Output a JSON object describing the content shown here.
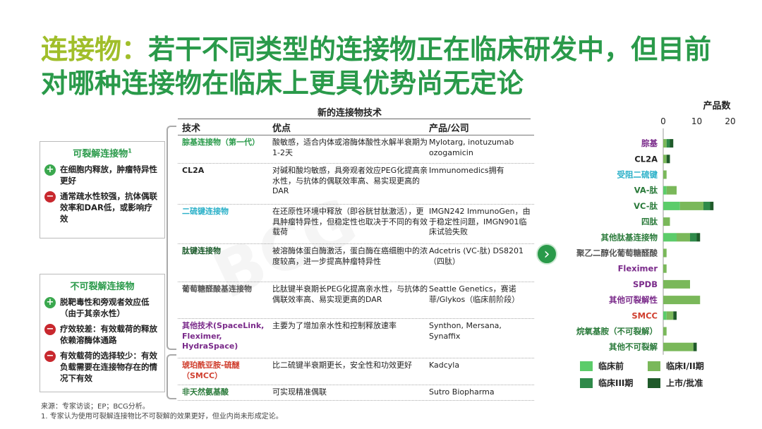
{
  "title": {
    "keyword": "连接物：",
    "rest": "若干不同类型的连接物正在临床研发中，但目前对哪种连接物在临床上更具优势尚无定论"
  },
  "subtitle": "新的连接物技术",
  "cleavable": {
    "title": "可裂解连接物",
    "sup": "1",
    "pros_cons": [
      {
        "type": "plus",
        "text": "在细胞内释放，肿瘤特异性更好"
      },
      {
        "type": "minus",
        "text": "通常疏水性较强，抗体偶联效率和DAR低，或影响疗效"
      }
    ]
  },
  "noncleavable": {
    "title": "不可裂解连接物",
    "pros_cons": [
      {
        "type": "plus",
        "text": "脱靶毒性和旁观者效应低（由于其亲水性）"
      },
      {
        "type": "minus",
        "text": "疗效较差：有效载荷的释放依赖溶酶体通路"
      },
      {
        "type": "minus",
        "text": "有效载荷的选择较少：有效负载需要在连接物存在的情况下有效"
      }
    ]
  },
  "table": {
    "headers": [
      "技术",
      "优点",
      "产品/公司"
    ],
    "rows": [
      {
        "tech": "腙基连接物（第一代）",
        "tech_color": "#2a9a4a",
        "adv": "酸敏感，适合内体或溶酶体酸性水解半衰期为1-2天",
        "prod": "Mylotarg, inotuzumab ozogamicin"
      },
      {
        "tech": "CL2A",
        "tech_color": "#222222",
        "adv": "对碱和酸均敏感，具旁观者效应PEG化提高亲水性，与抗体的偶联效率高、易实现更高的DAR",
        "prod": "Immunomedics拥有"
      },
      {
        "tech": "二硫键连接物",
        "tech_color": "#2ab0c8",
        "adv": "在还原性环境中释放（即谷胱甘肽激活），更具肿瘤特异性，但稳定性也取决于不同的有效载荷",
        "prod": "IMGN242 ImmunoGen，由于稳定性问题，IMGN901临床试验失败"
      },
      {
        "tech": "肽键连接物",
        "tech_color": "#1a5a2a",
        "adv": "被溶酶体蛋白酶激活，蛋白酶在癌细胞中的浓度较高，进一步提高肿瘤特异性",
        "prod": "Adcetris (VC-肽) DS8201（四肽）"
      },
      {
        "tech": "葡萄糖醛酸基连接物",
        "tech_color": "#555555",
        "adv": "比肽键半衰期长PEG化提高亲水性，与抗体的偶联效率高、易实现更高的DAR",
        "prod": "Seattle Genetics，赛诺菲/Glykos（临床前阶段）"
      },
      {
        "tech": "其他技术(SpaceLink, Fleximer, HydraSpace)",
        "tech_color": "#7a2a8a",
        "adv": "主要为了增加亲水性和控制释放速率",
        "prod": "Synthon, Mersana, Synaffix"
      },
      {
        "tech": "琥珀酰亚胺-硫醚（SMCC）",
        "tech_color": "#d04030",
        "adv": "比二硫键半衰期更长，安全性和功效更好",
        "prod": "Kadcyla"
      },
      {
        "tech": "非天然氨基酸",
        "tech_color": "#2a7a3a",
        "adv": "可实现精准偶联",
        "prod": "Sutro Biopharma"
      }
    ]
  },
  "chart_data": {
    "type": "bar",
    "orientation": "horizontal",
    "stacked": true,
    "title": "产品数",
    "xlim": [
      0,
      20
    ],
    "xticks": [
      0,
      10,
      20
    ],
    "categories": [
      "腙基",
      "CL2A",
      "受阻二硫键",
      "VA-肽",
      "VC-肽",
      "四肽",
      "其他肽基连接物",
      "聚乙二醇化葡萄糖醛酸",
      "Fleximer",
      "SPDB",
      "其他可裂解性",
      "SMCC",
      "烷氧基胺（不可裂解）",
      "其他不可裂解"
    ],
    "category_colors": [
      "#7a2a8a",
      "#222222",
      "#2ab0c8",
      "#2a7a3a",
      "#2a7a3a",
      "#2a7a3a",
      "#2a7a3a",
      "#555555",
      "#7a2a8a",
      "#7a2a8a",
      "#7a2a8a",
      "#d04030",
      "#2a7a3a",
      "#2a7a3a"
    ],
    "series": [
      {
        "name": "临床前",
        "color": "#5ccc6a",
        "values": [
          0,
          0,
          0,
          1,
          5,
          0,
          4,
          0,
          0,
          0,
          0,
          1,
          0,
          0
        ]
      },
      {
        "name": "临床I/II期",
        "color": "#7ab85a",
        "values": [
          1,
          1,
          1,
          3,
          7,
          2,
          4,
          1,
          1,
          8,
          11,
          2,
          1,
          9
        ]
      },
      {
        "name": "临床III期",
        "color": "#2f8a4a",
        "values": [
          1,
          0,
          0,
          0,
          2,
          0,
          2,
          0,
          0,
          0,
          0,
          0,
          0,
          0
        ]
      },
      {
        "name": "上市/批准",
        "color": "#1f5a2a",
        "values": [
          1,
          1,
          0,
          0,
          1,
          0,
          1,
          0,
          0,
          0,
          0,
          1,
          0,
          1
        ]
      }
    ]
  },
  "footnotes": [
    "来源：专家访谈；EP；BCG分析。",
    "1. 专家认为使用可裂解连接物比不可裂解的效果更好，但业内尚未形成定论。"
  ]
}
